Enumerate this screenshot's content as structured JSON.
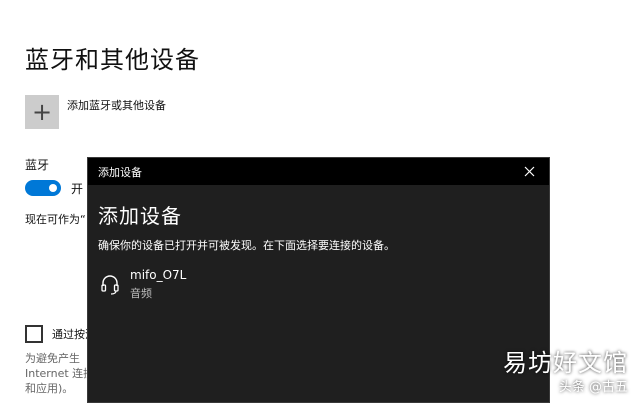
{
  "settings": {
    "title": "蓝牙和其他设备",
    "add_device_icon": "plus-icon",
    "add_device_label": "添加蓝牙或其他设备",
    "bluetooth_label": "蓝牙",
    "toggle_state": "开",
    "discoverable_text": "现在可作为“",
    "metered_label": "通过按流",
    "metered_desc": [
      "为避免产生",
      "Internet 连接",
      "和应用)。"
    ]
  },
  "dialog": {
    "titlebar": "添加设备",
    "close_icon": "close-icon",
    "heading": "添加设备",
    "instruction": "确保你的设备已打开并可被发现。在下面选择要连接的设备。",
    "devices": [
      {
        "name": "mifo_O7L",
        "type": "音频",
        "icon": "headset-icon"
      }
    ]
  },
  "watermark": {
    "line1": "易坊好文馆",
    "line2": "头条 @古五"
  },
  "colors": {
    "accent": "#0078d7",
    "dialog_bg": "#1f1f1f",
    "titlebar_bg": "#000000"
  }
}
